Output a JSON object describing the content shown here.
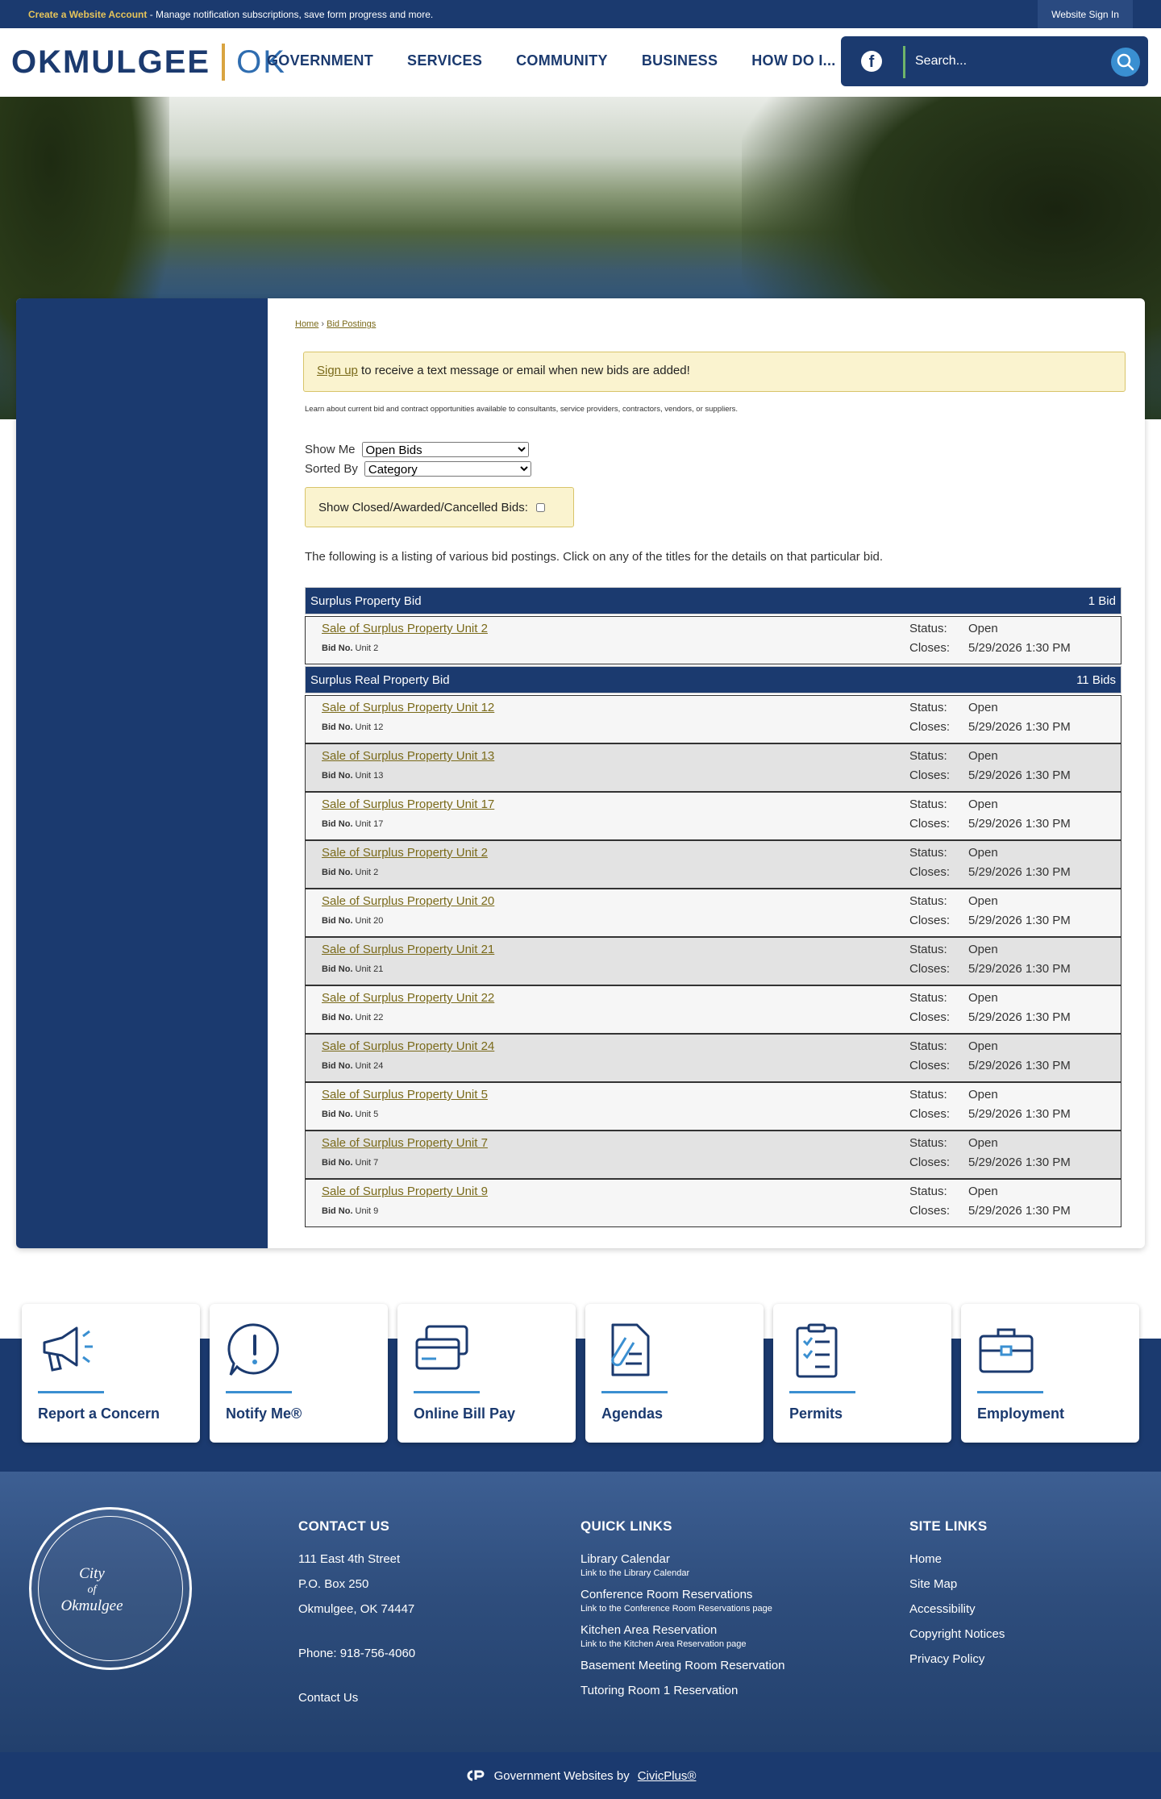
{
  "topbar": {
    "account_link": "Create a Website Account",
    "account_desc": " - Manage notification subscriptions, save form progress and more.",
    "signin": "Website Sign In"
  },
  "header": {
    "logo_name": "OKMULGEE",
    "logo_state": "OK",
    "nav": [
      "GOVERNMENT",
      "SERVICES",
      "COMMUNITY",
      "BUSINESS",
      "HOW DO I..."
    ],
    "search_placeholder": "Search..."
  },
  "breadcrumb": {
    "home": "Home",
    "sep": "›",
    "current": "Bid Postings"
  },
  "alert": {
    "link": "Sign up",
    "text": " to receive a text message or email when new bids are added!"
  },
  "intro": "Learn about current bid and contract opportunities available to consultants, service providers, contractors, vendors, or suppliers.",
  "filters": {
    "show_me_label": "Show Me",
    "show_me_value": "Open Bids",
    "sorted_by_label": "Sorted By",
    "sorted_by_value": "Category",
    "closed_label": "Show Closed/Awarded/Cancelled Bids:"
  },
  "listing_intro": "The following is a listing of various bid postings. Click on any of the titles for the details on that particular bid.",
  "labels": {
    "status": "Status:",
    "closes": "Closes:",
    "bidno": "Bid No."
  },
  "groups": [
    {
      "name": "Surplus Property Bid",
      "count": "1 Bid",
      "bids": [
        {
          "title": "Sale of Surplus Property Unit 2",
          "bidno": "Unit 2",
          "status": "Open",
          "closes": "5/29/2026 1:30 PM"
        }
      ]
    },
    {
      "name": "Surplus Real Property Bid",
      "count": "11 Bids",
      "bids": [
        {
          "title": "Sale of Surplus Property Unit 12",
          "bidno": "Unit 12",
          "status": "Open",
          "closes": "5/29/2026 1:30 PM"
        },
        {
          "title": "Sale of Surplus Property Unit 13",
          "bidno": "Unit 13",
          "status": "Open",
          "closes": "5/29/2026 1:30 PM"
        },
        {
          "title": "Sale of Surplus Property Unit 17",
          "bidno": "Unit 17",
          "status": "Open",
          "closes": "5/29/2026 1:30 PM"
        },
        {
          "title": "Sale of Surplus Property Unit 2",
          "bidno": "Unit 2",
          "status": "Open",
          "closes": "5/29/2026 1:30 PM"
        },
        {
          "title": "Sale of Surplus Property Unit 20",
          "bidno": "Unit 20",
          "status": "Open",
          "closes": "5/29/2026 1:30 PM"
        },
        {
          "title": "Sale of Surplus Property Unit 21",
          "bidno": "Unit 21",
          "status": "Open",
          "closes": "5/29/2026 1:30 PM"
        },
        {
          "title": "Sale of Surplus Property Unit 22",
          "bidno": "Unit 22",
          "status": "Open",
          "closes": "5/29/2026 1:30 PM"
        },
        {
          "title": "Sale of Surplus Property Unit 24",
          "bidno": "Unit 24",
          "status": "Open",
          "closes": "5/29/2026 1:30 PM"
        },
        {
          "title": "Sale of Surplus Property Unit 5",
          "bidno": "Unit 5",
          "status": "Open",
          "closes": "5/29/2026 1:30 PM"
        },
        {
          "title": "Sale of Surplus Property Unit 7",
          "bidno": "Unit 7",
          "status": "Open",
          "closes": "5/29/2026 1:30 PM"
        },
        {
          "title": "Sale of Surplus Property Unit 9",
          "bidno": "Unit 9",
          "status": "Open",
          "closes": "5/29/2026 1:30 PM"
        }
      ]
    }
  ],
  "tiles": [
    {
      "label": "Report a Concern",
      "icon": "megaphone-icon"
    },
    {
      "label": "Notify Me®",
      "icon": "alert-bubble-icon"
    },
    {
      "label": "Online Bill Pay",
      "icon": "credit-cards-icon"
    },
    {
      "label": "Agendas",
      "icon": "document-clip-icon"
    },
    {
      "label": "Permits",
      "icon": "clipboard-checklist-icon"
    },
    {
      "label": "Employment",
      "icon": "briefcase-icon"
    }
  ],
  "footer": {
    "seal_text": [
      "City",
      "of",
      "Okmulgee"
    ],
    "contact": {
      "heading": "CONTACT US",
      "lines": [
        "111 East 4th Street",
        "P.O. Box 250",
        "Okmulgee, OK 74447"
      ],
      "phone": "Phone: 918-756-4060",
      "link": "Contact Us"
    },
    "quick_links": {
      "heading": "QUICK LINKS",
      "items": [
        {
          "label": "Library Calendar",
          "sub": "Link to the Library Calendar"
        },
        {
          "label": "Conference Room Reservations",
          "sub": "Link to the Conference Room Reservations page"
        },
        {
          "label": "Kitchen Area Reservation",
          "sub": "Link to the Kitchen Area Reservation page"
        },
        {
          "label": "Basement Meeting Room Reservation",
          "sub": ""
        },
        {
          "label": "Tutoring Room 1 Reservation",
          "sub": ""
        }
      ]
    },
    "site_links": {
      "heading": "SITE LINKS",
      "items": [
        "Home",
        "Site Map",
        "Accessibility",
        "Copyright Notices",
        "Privacy Policy"
      ]
    }
  },
  "bottombar": {
    "text": "Government Websites by",
    "link": "CivicPlus®"
  },
  "colors": {
    "brand_navy": "#1b3a6f",
    "accent_gold": "#d9a441",
    "link_olive": "#7a6a1a",
    "alert_bg": "#faf3cf"
  }
}
